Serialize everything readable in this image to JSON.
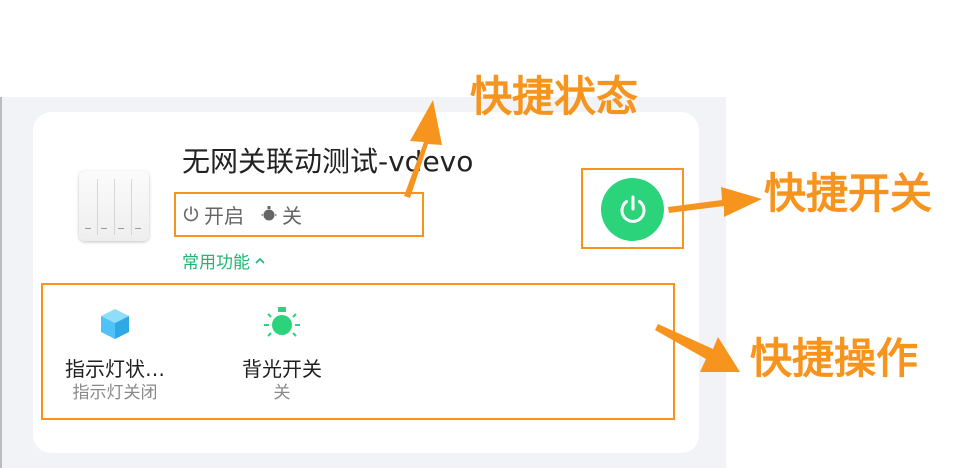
{
  "device": {
    "title": "无网关联动测试-vdevo",
    "status": [
      {
        "icon": "power-icon",
        "text": "开启"
      },
      {
        "icon": "bulb-icon",
        "text": "关"
      }
    ],
    "common_functions_label": "常用功能"
  },
  "quick_actions": [
    {
      "icon": "cube-icon",
      "title": "指示灯状…",
      "subtitle": "指示灯关闭"
    },
    {
      "icon": "green-bulb-icon",
      "title": "背光开关",
      "subtitle": "关"
    }
  ],
  "annotations": {
    "quick_status": "快捷状态",
    "quick_switch": "快捷开关",
    "quick_operation": "快捷操作"
  },
  "colors": {
    "accent_orange": "#f7941d",
    "power_green": "#2bd37a",
    "link_green": "#22b573",
    "cube_blue": "#4fc3f7"
  }
}
